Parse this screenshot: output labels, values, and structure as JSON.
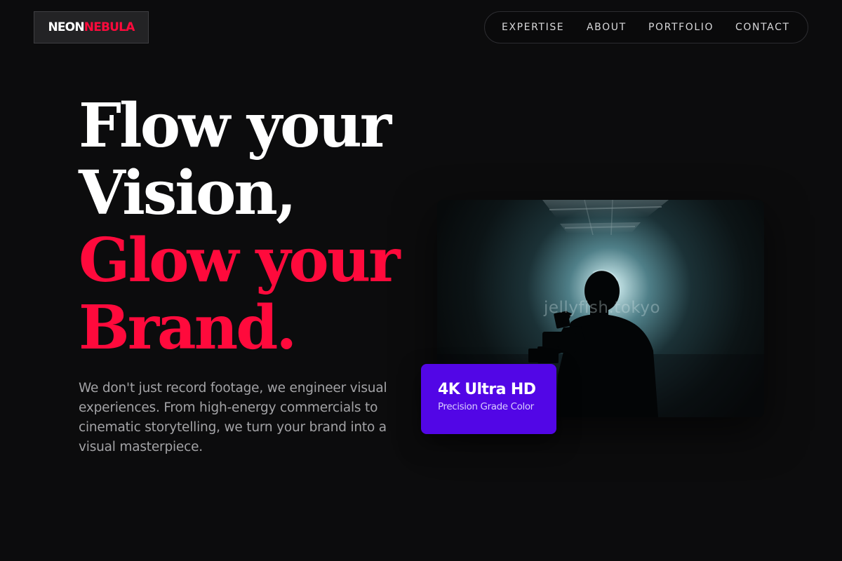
{
  "brand": {
    "part1": "NEON",
    "part2": "NEBULA",
    "accent_color": "#ff0a3c"
  },
  "nav": {
    "items": [
      "EXPERTISE",
      "ABOUT",
      "PORTFOLIO",
      "CONTACT"
    ]
  },
  "hero": {
    "headline": {
      "line1": "Flow your",
      "line2": "Vision,",
      "line3": "Glow your",
      "line4": "Brand."
    },
    "description": "We don't just record footage, we engineer visual experiences. From high-energy commercials to cinematic storytelling, we turn your brand into a visual masterpiece.",
    "image": {
      "subject": "silhouette of videographer holding a camera in front of a bright studio light",
      "watermark": "jellyfish.tokyo"
    },
    "badge": {
      "title": "4K Ultra HD",
      "subtitle": "Precision Grade Color",
      "color": "#5206e6"
    }
  },
  "colors": {
    "background": "#0c0c0d",
    "headline_white": "#ffffff",
    "headline_red": "#ff0a3c",
    "body_text": "#a3a3a6"
  }
}
